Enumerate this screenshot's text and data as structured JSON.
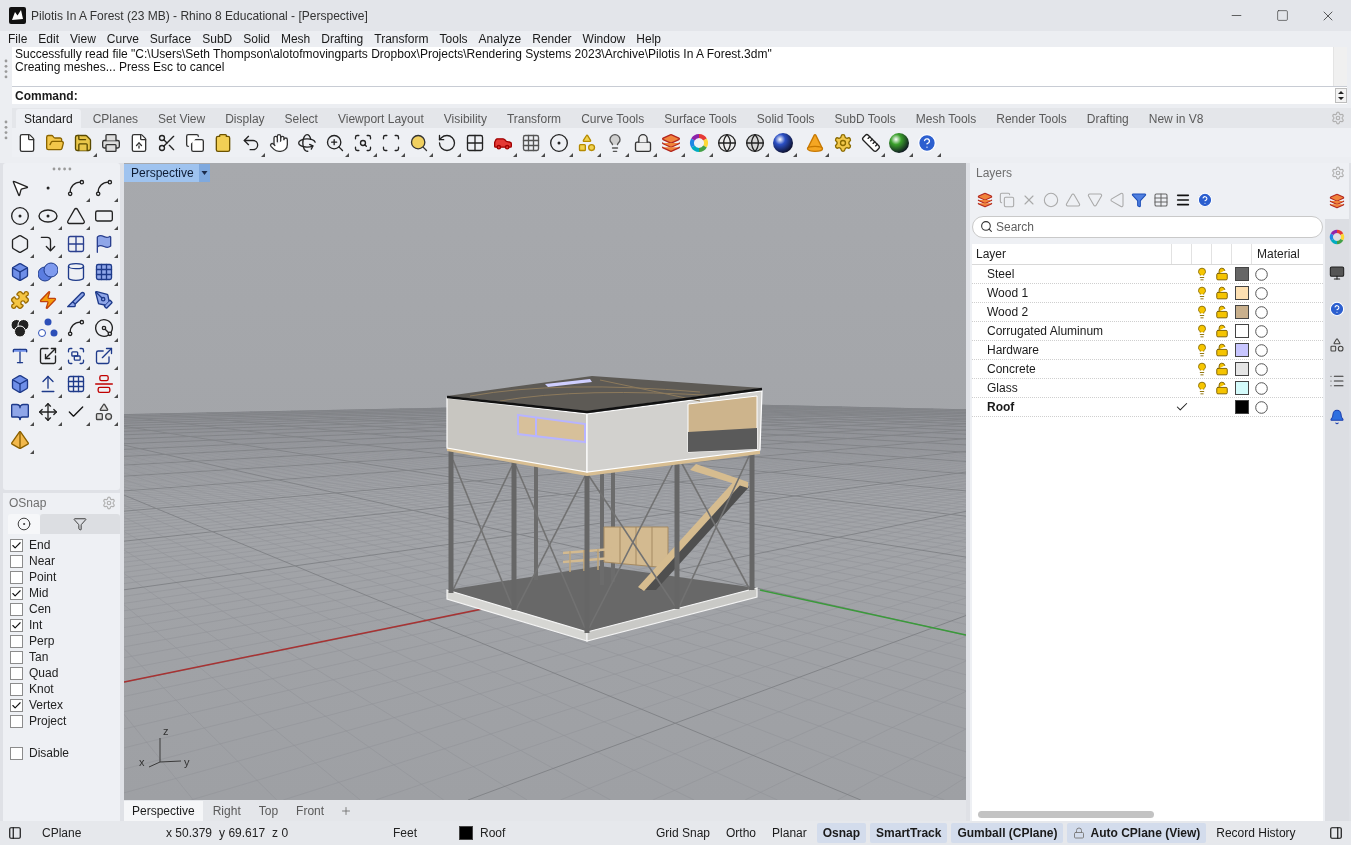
{
  "window": {
    "title": "Pilotis In A Forest (23 MB) - Rhino 8 Educational - [Perspective]"
  },
  "menu": [
    "File",
    "Edit",
    "View",
    "Curve",
    "Surface",
    "SubD",
    "Solid",
    "Mesh",
    "Drafting",
    "Transform",
    "Tools",
    "Analyze",
    "Render",
    "Window",
    "Help"
  ],
  "command_history": [
    "Successfully read file \"C:\\Users\\Seth Thompson\\alotofmovingparts Dropbox\\Projects\\Rendering Systems 2023\\Archive\\Pilotis In A Forest.3dm\"",
    "Creating meshes... Press Esc to cancel"
  ],
  "command_prompt": "Command:",
  "toolbar_tabs": [
    {
      "label": "Standard",
      "selected": true
    },
    {
      "label": "CPlanes",
      "selected": false
    },
    {
      "label": "Set View",
      "selected": false
    },
    {
      "label": "Display",
      "selected": false
    },
    {
      "label": "Select",
      "selected": false
    },
    {
      "label": "Viewport Layout",
      "selected": false
    },
    {
      "label": "Visibility",
      "selected": false
    },
    {
      "label": "Transform",
      "selected": false
    },
    {
      "label": "Curve Tools",
      "selected": false
    },
    {
      "label": "Surface Tools",
      "selected": false
    },
    {
      "label": "Solid Tools",
      "selected": false
    },
    {
      "label": "SubD Tools",
      "selected": false
    },
    {
      "label": "Mesh Tools",
      "selected": false
    },
    {
      "label": "Render Tools",
      "selected": false
    },
    {
      "label": "Drafting",
      "selected": false
    },
    {
      "label": "New in V8",
      "selected": false
    }
  ],
  "viewport": {
    "title": "Perspective",
    "axis_labels": {
      "z": "z",
      "x": "x",
      "y": "y"
    },
    "view_tabs": [
      {
        "label": "Perspective",
        "selected": true
      },
      {
        "label": "Right",
        "selected": false
      },
      {
        "label": "Top",
        "selected": false
      },
      {
        "label": "Front",
        "selected": false
      }
    ]
  },
  "osnap": {
    "title": "OSnap",
    "tabs": [
      {
        "kind": "snaps",
        "selected": true
      },
      {
        "kind": "filter",
        "selected": false
      }
    ],
    "options": [
      {
        "label": "End",
        "checked": true
      },
      {
        "label": "Near",
        "checked": false
      },
      {
        "label": "Point",
        "checked": false
      },
      {
        "label": "Mid",
        "checked": true
      },
      {
        "label": "Cen",
        "checked": false
      },
      {
        "label": "Int",
        "checked": true
      },
      {
        "label": "Perp",
        "checked": false
      },
      {
        "label": "Tan",
        "checked": false
      },
      {
        "label": "Quad",
        "checked": false
      },
      {
        "label": "Knot",
        "checked": false
      },
      {
        "label": "Vertex",
        "checked": true
      },
      {
        "label": "Project",
        "checked": false
      }
    ],
    "disable": {
      "label": "Disable",
      "checked": false
    }
  },
  "layers": {
    "title": "Layers",
    "search": {
      "placeholder": "Search"
    },
    "columns": {
      "layer": "Layer",
      "material": "Material"
    },
    "rows": [
      {
        "name": "Steel",
        "current": false,
        "on": true,
        "locked": false,
        "color": "#666666"
      },
      {
        "name": "Wood 1",
        "current": false,
        "on": true,
        "locked": false,
        "color": "#fde0b2"
      },
      {
        "name": "Wood 2",
        "current": false,
        "on": true,
        "locked": false,
        "color": "#c9b08d"
      },
      {
        "name": "Corrugated Aluminum",
        "current": false,
        "on": true,
        "locked": false,
        "color": "#ffffff"
      },
      {
        "name": "Hardware",
        "current": false,
        "on": true,
        "locked": false,
        "color": "#c8c6ff"
      },
      {
        "name": "Concrete",
        "current": false,
        "on": true,
        "locked": false,
        "color": "#e5e5e5"
      },
      {
        "name": "Glass",
        "current": false,
        "on": true,
        "locked": false,
        "color": "#d4fbfb"
      },
      {
        "name": "Roof",
        "current": true,
        "color": "#000000"
      }
    ]
  },
  "side_tabs": [
    {
      "kind": "layers",
      "selected": true
    },
    {
      "kind": "color",
      "selected": false
    },
    {
      "kind": "display",
      "selected": false
    },
    {
      "kind": "help",
      "selected": false
    },
    {
      "kind": "objects",
      "selected": false
    },
    {
      "kind": "properties",
      "selected": false
    },
    {
      "kind": "notifications",
      "selected": false
    }
  ],
  "status_bar": {
    "cplane": "CPlane",
    "coordinates": [
      "x 50.379",
      "y 69.617",
      "z 0"
    ],
    "units": "Feet",
    "layer": {
      "name": "Roof",
      "color": "#000000"
    },
    "toggles": [
      {
        "kind": "toggle",
        "label": "Grid Snap",
        "on": false
      },
      {
        "kind": "toggle",
        "label": "Ortho",
        "on": false
      },
      {
        "kind": "toggle",
        "label": "Planar",
        "on": false
      },
      {
        "kind": "toggle",
        "label": "Osnap",
        "on": true
      },
      {
        "kind": "toggle",
        "label": "SmartTrack",
        "on": true
      },
      {
        "kind": "toggle",
        "label": "Gumball (CPlane)",
        "on": true
      },
      {
        "kind": "lock_toggle",
        "label": "Auto CPlane (View)",
        "on": true
      },
      {
        "kind": "toggle",
        "label": "Record History",
        "on": false
      }
    ]
  }
}
